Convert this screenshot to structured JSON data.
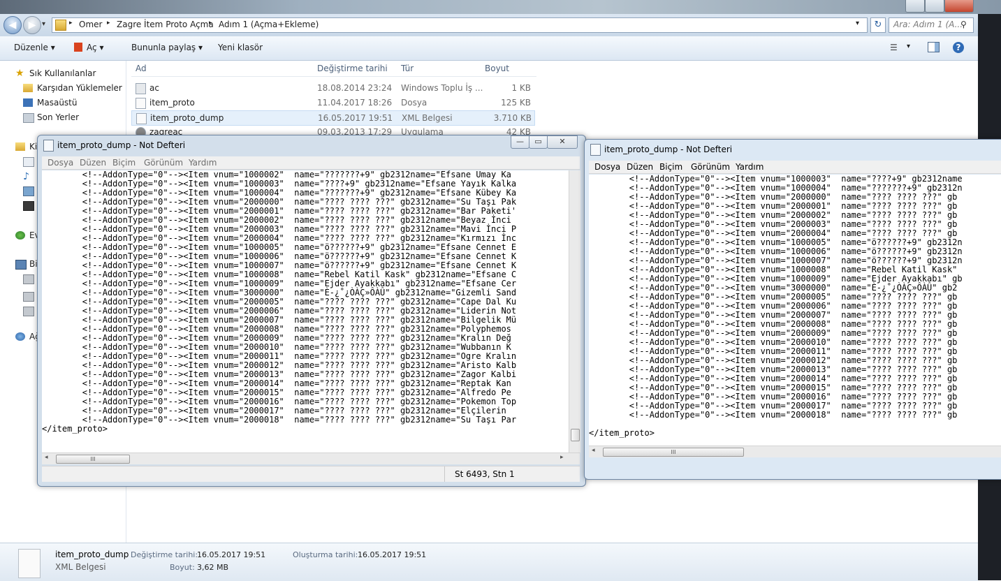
{
  "explorer": {
    "breadcrumb": [
      "Omer",
      "Zagre İtem Proto Açma",
      "Adım 1 (Açma+Ekleme)"
    ],
    "search_placeholder": "Ara: Adım 1 (A...",
    "toolbar": {
      "organize": "Düzenle",
      "open": "Aç",
      "share": "Bununla paylaş",
      "new_folder": "Yeni klasör"
    },
    "nav": {
      "favorites": "Sık Kullanılanlar",
      "downloads": "Karşıdan Yüklemeler",
      "desktop": "Masaüstü",
      "recent": "Son Yerler",
      "libraries_trunc": "Ki",
      "homegroup_trunc": "Ev",
      "computer_trunc": "Bi",
      "network_trunc": "Ağ"
    },
    "columns": {
      "name": "Ad",
      "modified": "Değiştirme tarihi",
      "type": "Tür",
      "size": "Boyut"
    },
    "files": [
      {
        "name": "ac",
        "date": "18.08.2014 23:24",
        "type": "Windows Toplu İş ...",
        "size": "1 KB"
      },
      {
        "name": "item_proto",
        "date": "11.04.2017 18:26",
        "type": "Dosya",
        "size": "125 KB"
      },
      {
        "name": "item_proto_dump",
        "date": "16.05.2017 19:51",
        "type": "XML Belgesi",
        "size": "3.710 KB"
      },
      {
        "name": "zagreac",
        "date": "09.03.2013 17:29",
        "type": "Uygulama",
        "size": "42 KB"
      }
    ],
    "details": {
      "file_name": "item_proto_dump",
      "file_type": "XML Belgesi",
      "modified_label": "Değiştirme tarihi:",
      "modified_value": "16.05.2017 19:51",
      "size_label": "Boyut:",
      "size_value": "3,62 MB",
      "created_label": "Oluşturma tarihi:",
      "created_value": "16.05.2017 19:51"
    }
  },
  "notepad_left": {
    "title": "item_proto_dump - Not Defteri",
    "menu": [
      "Dosya",
      "Düzen",
      "Biçim",
      "Görünüm",
      "Yardım"
    ],
    "status": "St 6493, Stn 1",
    "lines": [
      "        <!--AddonType=\"0\"--><Item vnum=\"1000002\"  name=\"???????+9\" gb2312name=\"Efsane Umay Ka",
      "        <!--AddonType=\"0\"--><Item vnum=\"1000003\"  name=\"????+9\" gb2312name=\"Efsane Yayık Kalka",
      "        <!--AddonType=\"0\"--><Item vnum=\"1000004\"  name=\"???????+9\" gb2312name=\"Efsane Kübey Ka",
      "        <!--AddonType=\"0\"--><Item vnum=\"2000000\"  name=\"???? ???? ???\" gb2312name=\"Su Taşı Pak",
      "        <!--AddonType=\"0\"--><Item vnum=\"2000001\"  name=\"???? ???? ???\" gb2312name=\"Bar Paketi'",
      "        <!--AddonType=\"0\"--><Item vnum=\"2000002\"  name=\"???? ???? ???\" gb2312name=\"Beyaz İnci",
      "        <!--AddonType=\"0\"--><Item vnum=\"2000003\"  name=\"???? ???? ???\" gb2312name=\"Mavi İnci P",
      "        <!--AddonType=\"0\"--><Item vnum=\"2000004\"  name=\"???? ???? ???\" gb2312name=\"Kırmızı İnc",
      "        <!--AddonType=\"0\"--><Item vnum=\"1000005\"  name=\"ö??????+9\" gb2312name=\"Efsane Cennet E",
      "        <!--AddonType=\"0\"--><Item vnum=\"1000006\"  name=\"ö??????+9\" gb2312name=\"Efsane Cennet K",
      "        <!--AddonType=\"0\"--><Item vnum=\"1000007\"  name=\"ö??????+9\" gb2312name=\"Efsane Cennet K",
      "        <!--AddonType=\"0\"--><Item vnum=\"1000008\"  name=\"Rebel Katil Kask\" gb2312name=\"Efsane C",
      "        <!--AddonType=\"0\"--><Item vnum=\"1000009\"  name=\"Ejder Ayakkabı\" gb2312name=\"Efsane Cer",
      "        <!--AddonType=\"0\"--><Item vnum=\"3000000\"  name=\"È-¿˚¿ÒÀÇ»ÔÀÛ\" gb2312name=\"Gizemli Sand",
      "        <!--AddonType=\"0\"--><Item vnum=\"2000005\"  name=\"???? ???? ???\" gb2312name=\"Cape Dal Ku",
      "        <!--AddonType=\"0\"--><Item vnum=\"2000006\"  name=\"???? ???? ???\" gb2312name=\"Liderin Not",
      "        <!--AddonType=\"0\"--><Item vnum=\"2000007\"  name=\"???? ???? ???\" gb2312name=\"Bilgelik Mü",
      "        <!--AddonType=\"0\"--><Item vnum=\"2000008\"  name=\"???? ???? ???\" gb2312name=\"Polyphemos",
      "        <!--AddonType=\"0\"--><Item vnum=\"2000009\"  name=\"???? ???? ???\" gb2312name=\"Kralın Değ",
      "        <!--AddonType=\"0\"--><Item vnum=\"2000010\"  name=\"???? ???? ???\" gb2312name=\"Wubbanın K",
      "        <!--AddonType=\"0\"--><Item vnum=\"2000011\"  name=\"???? ???? ???\" gb2312name=\"Ogre Kralın",
      "        <!--AddonType=\"0\"--><Item vnum=\"2000012\"  name=\"???? ???? ???\" gb2312name=\"Aristo Kalb",
      "        <!--AddonType=\"0\"--><Item vnum=\"2000013\"  name=\"???? ???? ???\" gb2312name=\"Zagor Kalbi",
      "        <!--AddonType=\"0\"--><Item vnum=\"2000014\"  name=\"???? ???? ???\" gb2312name=\"Reptak Kan",
      "        <!--AddonType=\"0\"--><Item vnum=\"2000015\"  name=\"???? ???? ???\" gb2312name=\"Alfredo Pe",
      "        <!--AddonType=\"0\"--><Item vnum=\"2000016\"  name=\"???? ???? ???\" gb2312name=\"Pokemon Top",
      "        <!--AddonType=\"0\"--><Item vnum=\"2000017\"  name=\"???? ???? ???\" gb2312name=\"Elçilerin",
      "        <!--AddonType=\"0\"--><Item vnum=\"2000018\"  name=\"???? ???? ???\" gb2312name=\"Su Taşı Par",
      "</item_proto>"
    ]
  },
  "notepad_right": {
    "title": "item_proto_dump - Not Defteri",
    "menu": [
      "Dosya",
      "Düzen",
      "Biçim",
      "Görünüm",
      "Yardım"
    ],
    "lines": [
      "        <!--AddonType=\"0\"--><Item vnum=\"1000003\"  name=\"????+9\" gb2312name",
      "        <!--AddonType=\"0\"--><Item vnum=\"1000004\"  name=\"???????+9\" gb2312n",
      "        <!--AddonType=\"0\"--><Item vnum=\"2000000\"  name=\"???? ???? ???\" gb",
      "        <!--AddonType=\"0\"--><Item vnum=\"2000001\"  name=\"???? ???? ???\" gb",
      "        <!--AddonType=\"0\"--><Item vnum=\"2000002\"  name=\"???? ???? ???\" gb",
      "        <!--AddonType=\"0\"--><Item vnum=\"2000003\"  name=\"???? ???? ???\" gb",
      "        <!--AddonType=\"0\"--><Item vnum=\"2000004\"  name=\"???? ???? ???\" gb",
      "        <!--AddonType=\"0\"--><Item vnum=\"1000005\"  name=\"ö??????+9\" gb2312n",
      "        <!--AddonType=\"0\"--><Item vnum=\"1000006\"  name=\"ö??????+9\" gb2312n",
      "        <!--AddonType=\"0\"--><Item vnum=\"1000007\"  name=\"ö??????+9\" gb2312n",
      "        <!--AddonType=\"0\"--><Item vnum=\"1000008\"  name=\"Rebel Katil Kask\" ",
      "        <!--AddonType=\"0\"--><Item vnum=\"1000009\"  name=\"Ejder Ayakkabı\" gb",
      "        <!--AddonType=\"0\"--><Item vnum=\"3000000\"  name=\"È-¿˚¿ÒÀÇ»ÔÀÛ\" gb2",
      "        <!--AddonType=\"0\"--><Item vnum=\"2000005\"  name=\"???? ???? ???\" gb",
      "        <!--AddonType=\"0\"--><Item vnum=\"2000006\"  name=\"???? ???? ???\" gb",
      "        <!--AddonType=\"0\"--><Item vnum=\"2000007\"  name=\"???? ???? ???\" gb",
      "        <!--AddonType=\"0\"--><Item vnum=\"2000008\"  name=\"???? ???? ???\" gb",
      "        <!--AddonType=\"0\"--><Item vnum=\"2000009\"  name=\"???? ???? ???\" gb",
      "        <!--AddonType=\"0\"--><Item vnum=\"2000010\"  name=\"???? ???? ???\" gb",
      "        <!--AddonType=\"0\"--><Item vnum=\"2000011\"  name=\"???? ???? ???\" gb",
      "        <!--AddonType=\"0\"--><Item vnum=\"2000012\"  name=\"???? ???? ???\" gb",
      "        <!--AddonType=\"0\"--><Item vnum=\"2000013\"  name=\"???? ???? ???\" gb",
      "        <!--AddonType=\"0\"--><Item vnum=\"2000014\"  name=\"???? ???? ???\" gb",
      "        <!--AddonType=\"0\"--><Item vnum=\"2000015\"  name=\"???? ???? ???\" gb",
      "        <!--AddonType=\"0\"--><Item vnum=\"2000016\"  name=\"???? ???? ???\" gb",
      "        <!--AddonType=\"0\"--><Item vnum=\"2000017\"  name=\"???? ???? ???\" gb",
      "        <!--AddonType=\"0\"--><Item vnum=\"2000018\"  name=\"???? ???? ???\" gb",
      "",
      "</item_proto>"
    ]
  },
  "glyphs": {
    "back": "◀",
    "forward": "▶",
    "dropdown": "▾",
    "refresh": "↻",
    "search": "⚲",
    "sep": "▸",
    "minimize": "—",
    "maximize": "▭",
    "close": "✕",
    "grip": "III",
    "help": "?",
    "views": "☰",
    "scroll_left": "◂",
    "scroll_right": "▸"
  }
}
